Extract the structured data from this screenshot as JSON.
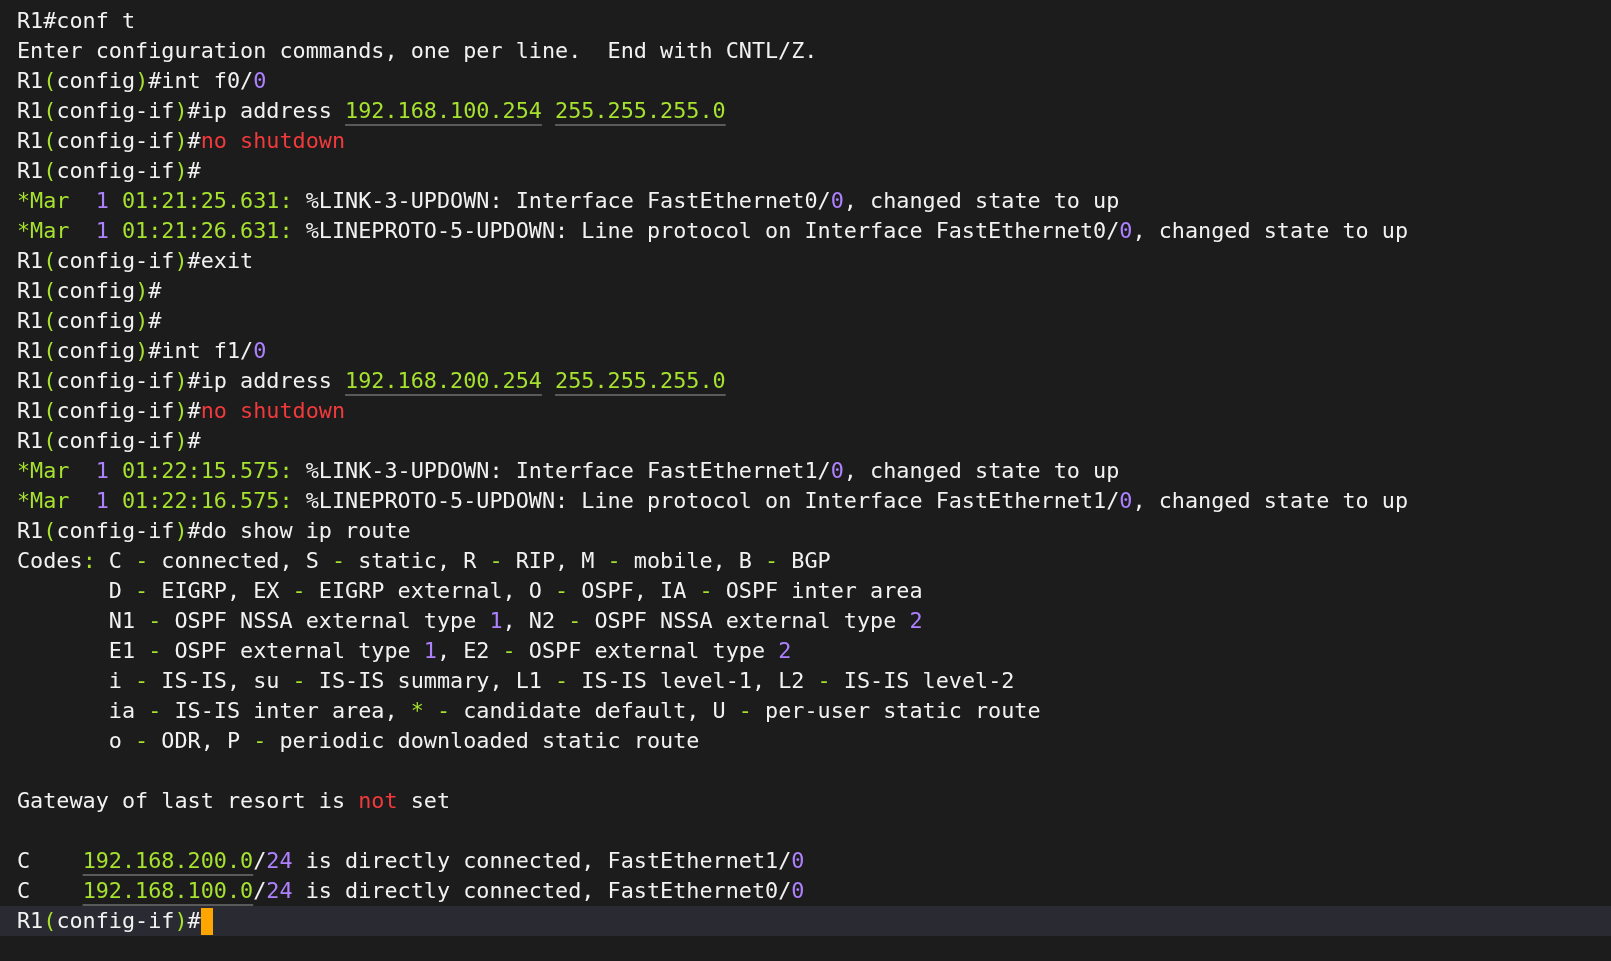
{
  "terminal": {
    "lines": [
      {
        "kind": "text",
        "segments": [
          {
            "text": "R1#conf t",
            "kind": "plain"
          }
        ]
      },
      {
        "kind": "text",
        "segments": [
          {
            "text": "Enter configuration commands, one per line.  End with CNTL/Z.",
            "kind": "plain"
          }
        ]
      },
      {
        "kind": "text",
        "segments": [
          {
            "text": "R1",
            "kind": "plain"
          },
          {
            "text": "(",
            "kind": "green"
          },
          {
            "text": "config",
            "kind": "plain"
          },
          {
            "text": ")",
            "kind": "green"
          },
          {
            "text": "#int f0/",
            "kind": "plain"
          },
          {
            "text": "0",
            "kind": "purple"
          }
        ]
      },
      {
        "kind": "text",
        "segments": [
          {
            "text": "R1",
            "kind": "plain"
          },
          {
            "text": "(",
            "kind": "green"
          },
          {
            "text": "config-if",
            "kind": "plain"
          },
          {
            "text": ")",
            "kind": "green"
          },
          {
            "text": "#ip address ",
            "kind": "plain"
          },
          {
            "text": "192.168.100.254",
            "kind": "address",
            "gap_after": true
          },
          {
            "text": "255.255.255.0",
            "kind": "address"
          }
        ]
      },
      {
        "kind": "text",
        "segments": [
          {
            "text": "R1",
            "kind": "plain"
          },
          {
            "text": "(",
            "kind": "green"
          },
          {
            "text": "config-if",
            "kind": "plain"
          },
          {
            "text": ")",
            "kind": "green"
          },
          {
            "text": "#",
            "kind": "plain"
          },
          {
            "text": "no shutdown",
            "kind": "red"
          }
        ]
      },
      {
        "kind": "text",
        "segments": [
          {
            "text": "R1",
            "kind": "plain"
          },
          {
            "text": "(",
            "kind": "green"
          },
          {
            "text": "config-if",
            "kind": "plain"
          },
          {
            "text": ")",
            "kind": "green"
          },
          {
            "text": "#",
            "kind": "plain"
          }
        ]
      },
      {
        "kind": "text",
        "segments": [
          {
            "text": "*Mar  ",
            "kind": "green"
          },
          {
            "text": "1",
            "kind": "purple"
          },
          {
            "text": " 01:21:25.631:",
            "kind": "green"
          },
          {
            "text": " %LINK-3-UPDOWN: Interface FastEthernet0/",
            "kind": "plain"
          },
          {
            "text": "0",
            "kind": "purple"
          },
          {
            "text": ", changed state to up",
            "kind": "plain"
          }
        ]
      },
      {
        "kind": "text",
        "segments": [
          {
            "text": "*Mar  ",
            "kind": "green"
          },
          {
            "text": "1",
            "kind": "purple"
          },
          {
            "text": " 01:21:26.631:",
            "kind": "green"
          },
          {
            "text": " %LINEPROTO-5-UPDOWN: Line protocol on Interface FastEthernet0/",
            "kind": "plain"
          },
          {
            "text": "0",
            "kind": "purple"
          },
          {
            "text": ", changed state to up",
            "kind": "plain"
          }
        ]
      },
      {
        "kind": "text",
        "segments": [
          {
            "text": "R1",
            "kind": "plain"
          },
          {
            "text": "(",
            "kind": "green"
          },
          {
            "text": "config-if",
            "kind": "plain"
          },
          {
            "text": ")",
            "kind": "green"
          },
          {
            "text": "#exit",
            "kind": "plain"
          }
        ]
      },
      {
        "kind": "text",
        "segments": [
          {
            "text": "R1",
            "kind": "plain"
          },
          {
            "text": "(",
            "kind": "green"
          },
          {
            "text": "config",
            "kind": "plain"
          },
          {
            "text": ")",
            "kind": "green"
          },
          {
            "text": "#",
            "kind": "plain"
          }
        ]
      },
      {
        "kind": "text",
        "segments": [
          {
            "text": "R1",
            "kind": "plain"
          },
          {
            "text": "(",
            "kind": "green"
          },
          {
            "text": "config",
            "kind": "plain"
          },
          {
            "text": ")",
            "kind": "green"
          },
          {
            "text": "#",
            "kind": "plain"
          }
        ]
      },
      {
        "kind": "text",
        "segments": [
          {
            "text": "R1",
            "kind": "plain"
          },
          {
            "text": "(",
            "kind": "green"
          },
          {
            "text": "config",
            "kind": "plain"
          },
          {
            "text": ")",
            "kind": "green"
          },
          {
            "text": "#int f1/",
            "kind": "plain"
          },
          {
            "text": "0",
            "kind": "purple"
          }
        ]
      },
      {
        "kind": "text",
        "segments": [
          {
            "text": "R1",
            "kind": "plain"
          },
          {
            "text": "(",
            "kind": "green"
          },
          {
            "text": "config-if",
            "kind": "plain"
          },
          {
            "text": ")",
            "kind": "green"
          },
          {
            "text": "#ip address ",
            "kind": "plain"
          },
          {
            "text": "192.168.200.254",
            "kind": "address",
            "gap_after": true
          },
          {
            "text": "255.255.255.0",
            "kind": "address"
          }
        ]
      },
      {
        "kind": "text",
        "segments": [
          {
            "text": "R1",
            "kind": "plain"
          },
          {
            "text": "(",
            "kind": "green"
          },
          {
            "text": "config-if",
            "kind": "plain"
          },
          {
            "text": ")",
            "kind": "green"
          },
          {
            "text": "#",
            "kind": "plain"
          },
          {
            "text": "no shutdown",
            "kind": "red"
          }
        ]
      },
      {
        "kind": "text",
        "segments": [
          {
            "text": "R1",
            "kind": "plain"
          },
          {
            "text": "(",
            "kind": "green"
          },
          {
            "text": "config-if",
            "kind": "plain"
          },
          {
            "text": ")",
            "kind": "green"
          },
          {
            "text": "#",
            "kind": "plain"
          }
        ]
      },
      {
        "kind": "text",
        "segments": [
          {
            "text": "*Mar  ",
            "kind": "green"
          },
          {
            "text": "1",
            "kind": "purple"
          },
          {
            "text": " 01:22:15.575:",
            "kind": "green"
          },
          {
            "text": " %LINK-3-UPDOWN: Interface FastEthernet1/",
            "kind": "plain"
          },
          {
            "text": "0",
            "kind": "purple"
          },
          {
            "text": ", changed state to up",
            "kind": "plain"
          }
        ]
      },
      {
        "kind": "text",
        "segments": [
          {
            "text": "*Mar  ",
            "kind": "green"
          },
          {
            "text": "1",
            "kind": "purple"
          },
          {
            "text": " 01:22:16.575:",
            "kind": "green"
          },
          {
            "text": " %LINEPROTO-5-UPDOWN: Line protocol on Interface FastEthernet1/",
            "kind": "plain"
          },
          {
            "text": "0",
            "kind": "purple"
          },
          {
            "text": ", changed state to up",
            "kind": "plain"
          }
        ]
      },
      {
        "kind": "text",
        "segments": [
          {
            "text": "R1",
            "kind": "plain"
          },
          {
            "text": "(",
            "kind": "green"
          },
          {
            "text": "config-if",
            "kind": "plain"
          },
          {
            "text": ")",
            "kind": "green"
          },
          {
            "text": "#do show ip route",
            "kind": "plain"
          }
        ]
      },
      {
        "kind": "text",
        "segments": [
          {
            "text": "Codes",
            "kind": "plain"
          },
          {
            "text": ":",
            "kind": "green"
          },
          {
            "text": " C ",
            "kind": "plain"
          },
          {
            "text": "-",
            "kind": "green"
          },
          {
            "text": " connected, S ",
            "kind": "plain"
          },
          {
            "text": "-",
            "kind": "green"
          },
          {
            "text": " static, R ",
            "kind": "plain"
          },
          {
            "text": "-",
            "kind": "green"
          },
          {
            "text": " RIP, M ",
            "kind": "plain"
          },
          {
            "text": "-",
            "kind": "green"
          },
          {
            "text": " mobile, B ",
            "kind": "plain"
          },
          {
            "text": "-",
            "kind": "green"
          },
          {
            "text": " BGP",
            "kind": "plain"
          }
        ]
      },
      {
        "kind": "text",
        "segments": [
          {
            "text": "       D ",
            "kind": "plain"
          },
          {
            "text": "-",
            "kind": "green"
          },
          {
            "text": " EIGRP, EX ",
            "kind": "plain"
          },
          {
            "text": "-",
            "kind": "green"
          },
          {
            "text": " EIGRP external, O ",
            "kind": "plain"
          },
          {
            "text": "-",
            "kind": "green"
          },
          {
            "text": " OSPF, IA ",
            "kind": "plain"
          },
          {
            "text": "-",
            "kind": "green"
          },
          {
            "text": " OSPF inter area",
            "kind": "plain"
          }
        ]
      },
      {
        "kind": "text",
        "segments": [
          {
            "text": "       N1 ",
            "kind": "plain"
          },
          {
            "text": "-",
            "kind": "green"
          },
          {
            "text": " OSPF NSSA external type ",
            "kind": "plain"
          },
          {
            "text": "1",
            "kind": "purple"
          },
          {
            "text": ", N2 ",
            "kind": "plain"
          },
          {
            "text": "-",
            "kind": "green"
          },
          {
            "text": " OSPF NSSA external type ",
            "kind": "plain"
          },
          {
            "text": "2",
            "kind": "purple"
          }
        ]
      },
      {
        "kind": "text",
        "segments": [
          {
            "text": "       E1 ",
            "kind": "plain"
          },
          {
            "text": "-",
            "kind": "green"
          },
          {
            "text": " OSPF external type ",
            "kind": "plain"
          },
          {
            "text": "1",
            "kind": "purple"
          },
          {
            "text": ", E2 ",
            "kind": "plain"
          },
          {
            "text": "-",
            "kind": "green"
          },
          {
            "text": " OSPF external type ",
            "kind": "plain"
          },
          {
            "text": "2",
            "kind": "purple"
          }
        ]
      },
      {
        "kind": "text",
        "segments": [
          {
            "text": "       i ",
            "kind": "plain"
          },
          {
            "text": "-",
            "kind": "green"
          },
          {
            "text": " IS-IS, su ",
            "kind": "plain"
          },
          {
            "text": "-",
            "kind": "green"
          },
          {
            "text": " IS-IS summary, L1 ",
            "kind": "plain"
          },
          {
            "text": "-",
            "kind": "green"
          },
          {
            "text": " IS-IS level-1, L2 ",
            "kind": "plain"
          },
          {
            "text": "-",
            "kind": "green"
          },
          {
            "text": " IS-IS level-2",
            "kind": "plain"
          }
        ]
      },
      {
        "kind": "text",
        "segments": [
          {
            "text": "       ia ",
            "kind": "plain"
          },
          {
            "text": "-",
            "kind": "green"
          },
          {
            "text": " IS-IS inter area, ",
            "kind": "plain"
          },
          {
            "text": "* -",
            "kind": "green"
          },
          {
            "text": " candidate default, U ",
            "kind": "plain"
          },
          {
            "text": "-",
            "kind": "green"
          },
          {
            "text": " per-user static route",
            "kind": "plain"
          }
        ]
      },
      {
        "kind": "text",
        "segments": [
          {
            "text": "       o ",
            "kind": "plain"
          },
          {
            "text": "-",
            "kind": "green"
          },
          {
            "text": " ODR, P ",
            "kind": "plain"
          },
          {
            "text": "-",
            "kind": "green"
          },
          {
            "text": " periodic downloaded static route",
            "kind": "plain"
          }
        ]
      },
      {
        "kind": "blank"
      },
      {
        "kind": "text",
        "segments": [
          {
            "text": "Gateway of last resort is ",
            "kind": "plain"
          },
          {
            "text": "not",
            "kind": "red"
          },
          {
            "text": " set",
            "kind": "plain"
          }
        ]
      },
      {
        "kind": "blank"
      },
      {
        "kind": "text",
        "segments": [
          {
            "text": "C    ",
            "kind": "plain"
          },
          {
            "text": "192.168.200.0",
            "kind": "address"
          },
          {
            "text": "/",
            "kind": "plain"
          },
          {
            "text": "24",
            "kind": "purple"
          },
          {
            "text": " is directly connected, FastEthernet1/",
            "kind": "plain"
          },
          {
            "text": "0",
            "kind": "purple"
          }
        ]
      },
      {
        "kind": "text",
        "segments": [
          {
            "text": "C    ",
            "kind": "plain"
          },
          {
            "text": "192.168.100.0",
            "kind": "address"
          },
          {
            "text": "/",
            "kind": "plain"
          },
          {
            "text": "24",
            "kind": "purple"
          },
          {
            "text": " is directly connected, FastEthernet0/",
            "kind": "plain"
          },
          {
            "text": "0",
            "kind": "purple"
          }
        ]
      },
      {
        "kind": "text",
        "active": true,
        "segments": [
          {
            "text": "R1",
            "kind": "plain"
          },
          {
            "text": "(",
            "kind": "green"
          },
          {
            "text": "config-if",
            "kind": "plain"
          },
          {
            "text": ")",
            "kind": "green"
          },
          {
            "text": "#",
            "kind": "plain"
          }
        ]
      }
    ]
  }
}
